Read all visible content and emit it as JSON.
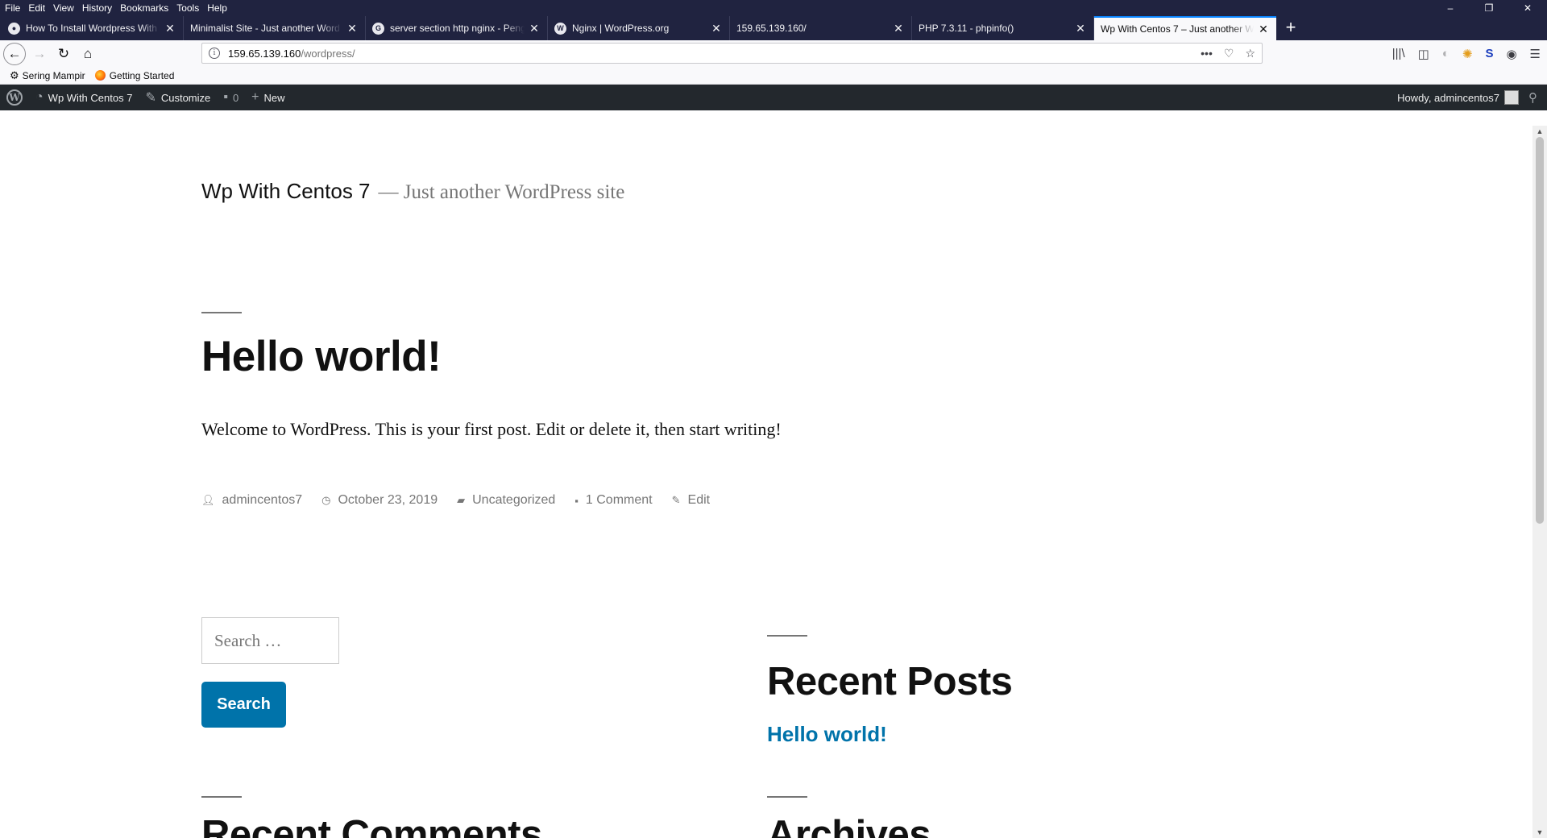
{
  "menubar": {
    "items": [
      "File",
      "Edit",
      "View",
      "History",
      "Bookmarks",
      "Tools",
      "Help"
    ],
    "window_controls": [
      "–",
      "❐",
      "✕"
    ]
  },
  "tabs": [
    {
      "title": "How To Install Wordpress With",
      "icon": "site-icon"
    },
    {
      "title": "Minimalist Site - Just another Word",
      "icon": "none"
    },
    {
      "title": "server section http nginx - Peng",
      "icon": "google-icon"
    },
    {
      "title": "Nginx | WordPress.org",
      "icon": "wordpress-icon"
    },
    {
      "title": "159.65.139.160/",
      "icon": "none"
    },
    {
      "title": "PHP 7.3.11 - phpinfo()",
      "icon": "none"
    },
    {
      "title": "Wp With Centos 7 – Just another W",
      "icon": "none",
      "active": true
    }
  ],
  "navbar": {
    "url_host": "159.65.139.160",
    "url_path": "/wordpress/"
  },
  "bookmarks": [
    {
      "label": "Sering Mampir",
      "icon": "gear-icon"
    },
    {
      "label": "Getting Started",
      "icon": "firefox-icon"
    }
  ],
  "adminbar": {
    "site_name": "Wp With Centos 7",
    "customize": "Customize",
    "comments_count": "0",
    "new": "New",
    "howdy": "Howdy, admincentos7"
  },
  "site": {
    "title": "Wp With Centos 7",
    "dash": "—",
    "description": "Just another WordPress site"
  },
  "post": {
    "title": "Hello world!",
    "content": "Welcome to WordPress. This is your first post. Edit or delete it, then start writing!",
    "author": "admincentos7",
    "date": "October 23, 2019",
    "category": "Uncategorized",
    "comments": "1 Comment",
    "edit": "Edit"
  },
  "widgets": {
    "search_placeholder": "Search …",
    "search_button": "Search",
    "recent_posts_title": "Recent Posts",
    "recent_posts": [
      "Hello world!"
    ],
    "recent_comments_title": "Recent Comments",
    "archives_title": "Archives"
  },
  "colors": {
    "accent": "#0073aa",
    "adminbar": "#23282d",
    "browser_chrome": "#202340"
  }
}
